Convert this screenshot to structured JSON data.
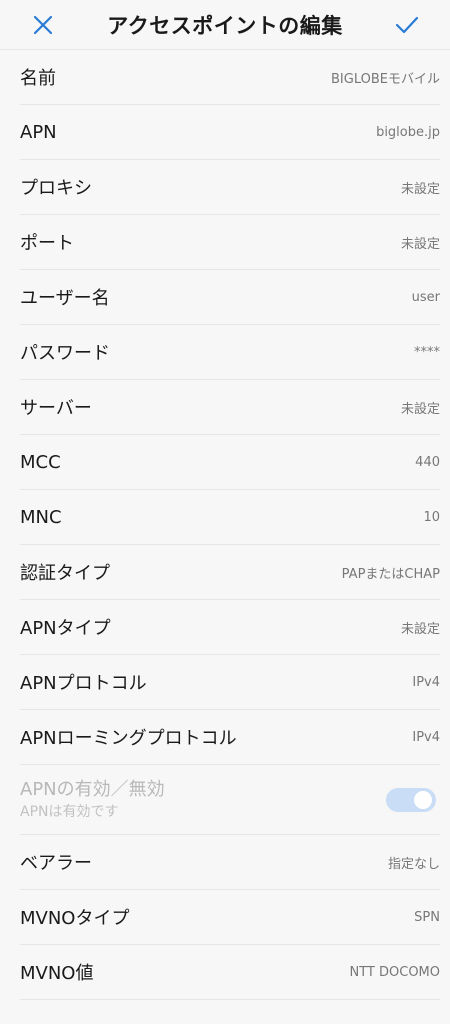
{
  "colors": {
    "accent": "#2a7bd6",
    "switch_track": "#c9ddf6"
  },
  "header": {
    "title": "アクセスポイントの編集",
    "close_icon": "close-icon",
    "confirm_icon": "check-icon"
  },
  "items": [
    {
      "label": "名前",
      "value": "BIGLOBEモバイル"
    },
    {
      "label": "APN",
      "value": "biglobe.jp"
    },
    {
      "label": "プロキシ",
      "value": "未設定"
    },
    {
      "label": "ポート",
      "value": "未設定"
    },
    {
      "label": "ユーザー名",
      "value": "user"
    },
    {
      "label": "パスワード",
      "value": "****"
    },
    {
      "label": "サーバー",
      "value": "未設定"
    },
    {
      "label": "MCC",
      "value": "440"
    },
    {
      "label": "MNC",
      "value": "10"
    },
    {
      "label": "認証タイプ",
      "value": "PAPまたはCHAP"
    },
    {
      "label": "APNタイプ",
      "value": "未設定"
    },
    {
      "label": "APNプロトコル",
      "value": "IPv4"
    },
    {
      "label": "APNローミングプロトコル",
      "value": "IPv4"
    }
  ],
  "apn_toggle": {
    "title": "APNの有効／無効",
    "subtitle": "APNは有効です",
    "enabled": true
  },
  "items_after": [
    {
      "label": "ベアラー",
      "value": "指定なし"
    },
    {
      "label": "MVNOタイプ",
      "value": "SPN"
    },
    {
      "label": "MVNO値",
      "value": "NTT DOCOMO"
    }
  ]
}
